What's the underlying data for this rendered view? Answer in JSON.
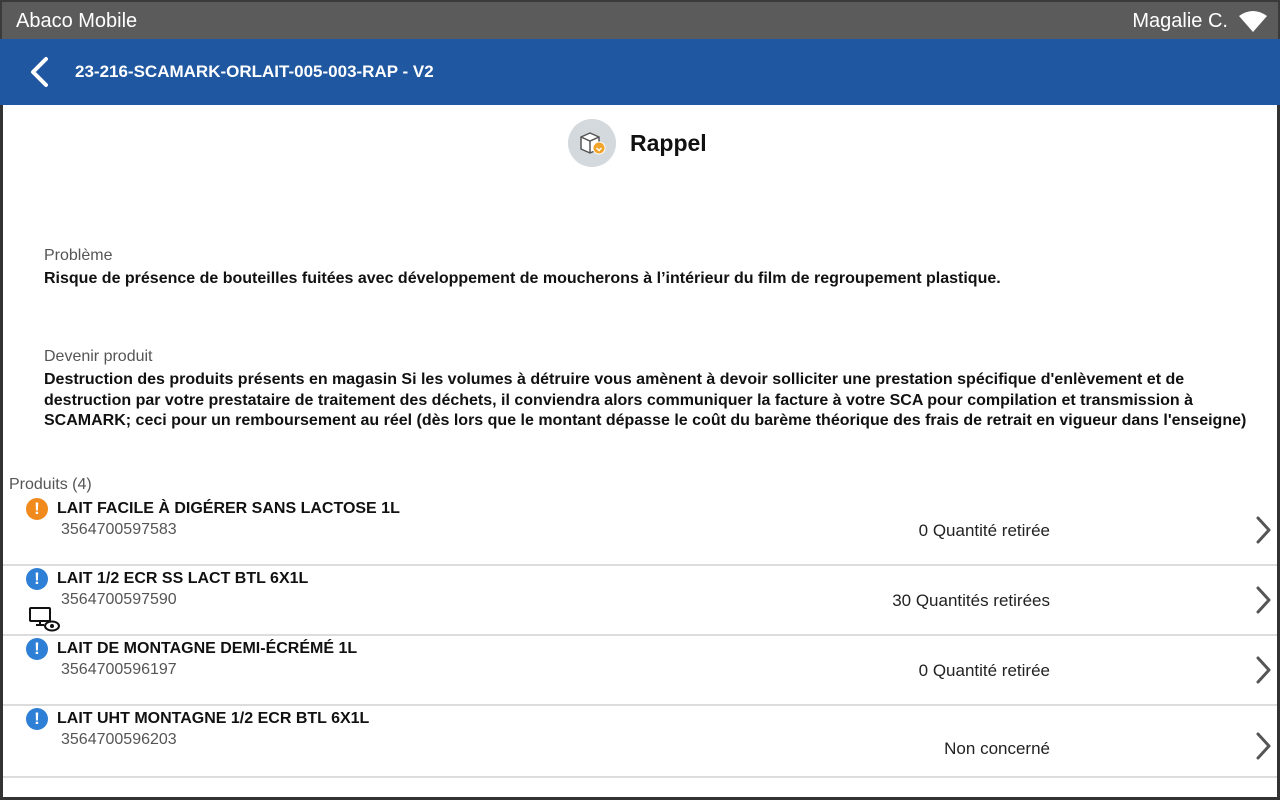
{
  "status_bar": {
    "app_name": "Abaco Mobile",
    "user_name": "Magalie C.",
    "wifi_icon": "wifi-icon"
  },
  "header": {
    "title": "23-216-SCAMARK-ORLAIT-005-003-RAP - V2",
    "back_icon": "chevron-left-icon",
    "background": "#1f57a1"
  },
  "content": {
    "type_icon": "box-recall-icon",
    "type_title": "Rappel",
    "probleme": {
      "label": "Problème",
      "value": "Risque de présence de bouteilles fuitées avec développement de moucherons à l’intérieur du film de regroupement plastique."
    },
    "devenir": {
      "label": "Devenir produit",
      "value": "Destruction des produits présents en magasin Si les volumes à détruire vous amènent à devoir solliciter une prestation spécifique d'enlèvement et de destruction par votre prestataire de traitement des déchets, il conviendra alors communiquer la facture à votre SCA pour compilation et transmission à SCAMARK; ceci pour un remboursement au réel (dès lors que le montant dépasse le coût du barème théorique des frais de retrait en vigueur dans l'enseigne)"
    },
    "products_header": "Produits (4)",
    "products": [
      {
        "name": "LAIT FACILE À DIGÉRER SANS LACTOSE 1L",
        "ean": "3564700597583",
        "quantity": "0 Quantité retirée",
        "alert_color": "orange",
        "has_device_icon": false
      },
      {
        "name": "LAIT 1/2 ECR SS LACT BTL 6X1L",
        "ean": "3564700597590",
        "quantity": "30 Quantités retirées",
        "alert_color": "blue",
        "has_device_icon": true
      },
      {
        "name": "LAIT DE MONTAGNE DEMI-ÉCRÉMÉ 1L",
        "ean": "3564700596197",
        "quantity": "0 Quantité retirée",
        "alert_color": "blue",
        "has_device_icon": false
      },
      {
        "name": "LAIT UHT MONTAGNE 1/2 ECR BTL 6X1L",
        "ean": "3564700596203",
        "quantity": "Non concerné",
        "alert_color": "blue",
        "has_device_icon": false
      }
    ]
  }
}
